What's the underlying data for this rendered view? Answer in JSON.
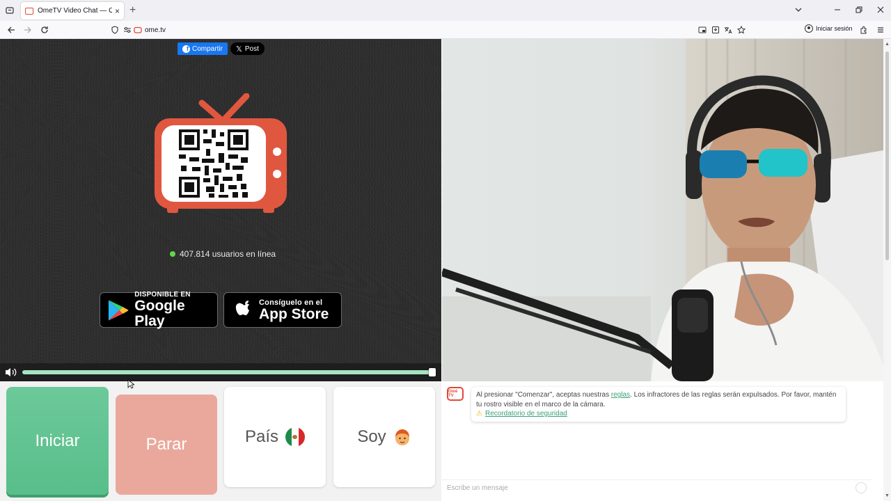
{
  "browser": {
    "tab_title": "OmeTV Video Chat — Omegle",
    "tab_close": "×",
    "new_tab": "+",
    "url": "ome.tv",
    "sign_in": "Iniciar sesión",
    "icons": [
      "tab-list-icon",
      "back-icon",
      "forward-icon",
      "reload-icon",
      "shield-icon",
      "permissions-icon",
      "site-icon",
      "picture-in-picture-icon",
      "save-icon",
      "translate-icon",
      "bookmark-star-icon",
      "account-icon",
      "extensions-icon",
      "menu-icon",
      "chevron-down-icon",
      "minimize-icon",
      "restore-icon",
      "close-icon"
    ]
  },
  "left": {
    "share_label": "Compartir",
    "post_label": "Post",
    "online_text": "407.814 usuarios en línea",
    "online_color": "#62d64a",
    "google_small": "DISPONIBLE EN",
    "google_big": "Google Play",
    "apple_small": "Consíguelo en el",
    "apple_big": "App Store",
    "volume_level": 1.0
  },
  "controls": {
    "start_label": "Iniciar",
    "stop_label": "Parar",
    "country_label": "País",
    "me_label": "Soy",
    "start_color": "#5fc391",
    "stop_color": "#eaa89c"
  },
  "chat": {
    "logo_text": "Omé TV",
    "notice_before": "Al presionar \"Comenzar\", aceptas nuestras ",
    "notice_link": "reglas",
    "notice_after": ". Los infractores de las reglas serán expulsados. Por favor, mantén tu rostro visible en el marco de la cámara.",
    "safety_link": "Recordatorio de seguridad",
    "input_placeholder": "Escribe un mensaje"
  }
}
